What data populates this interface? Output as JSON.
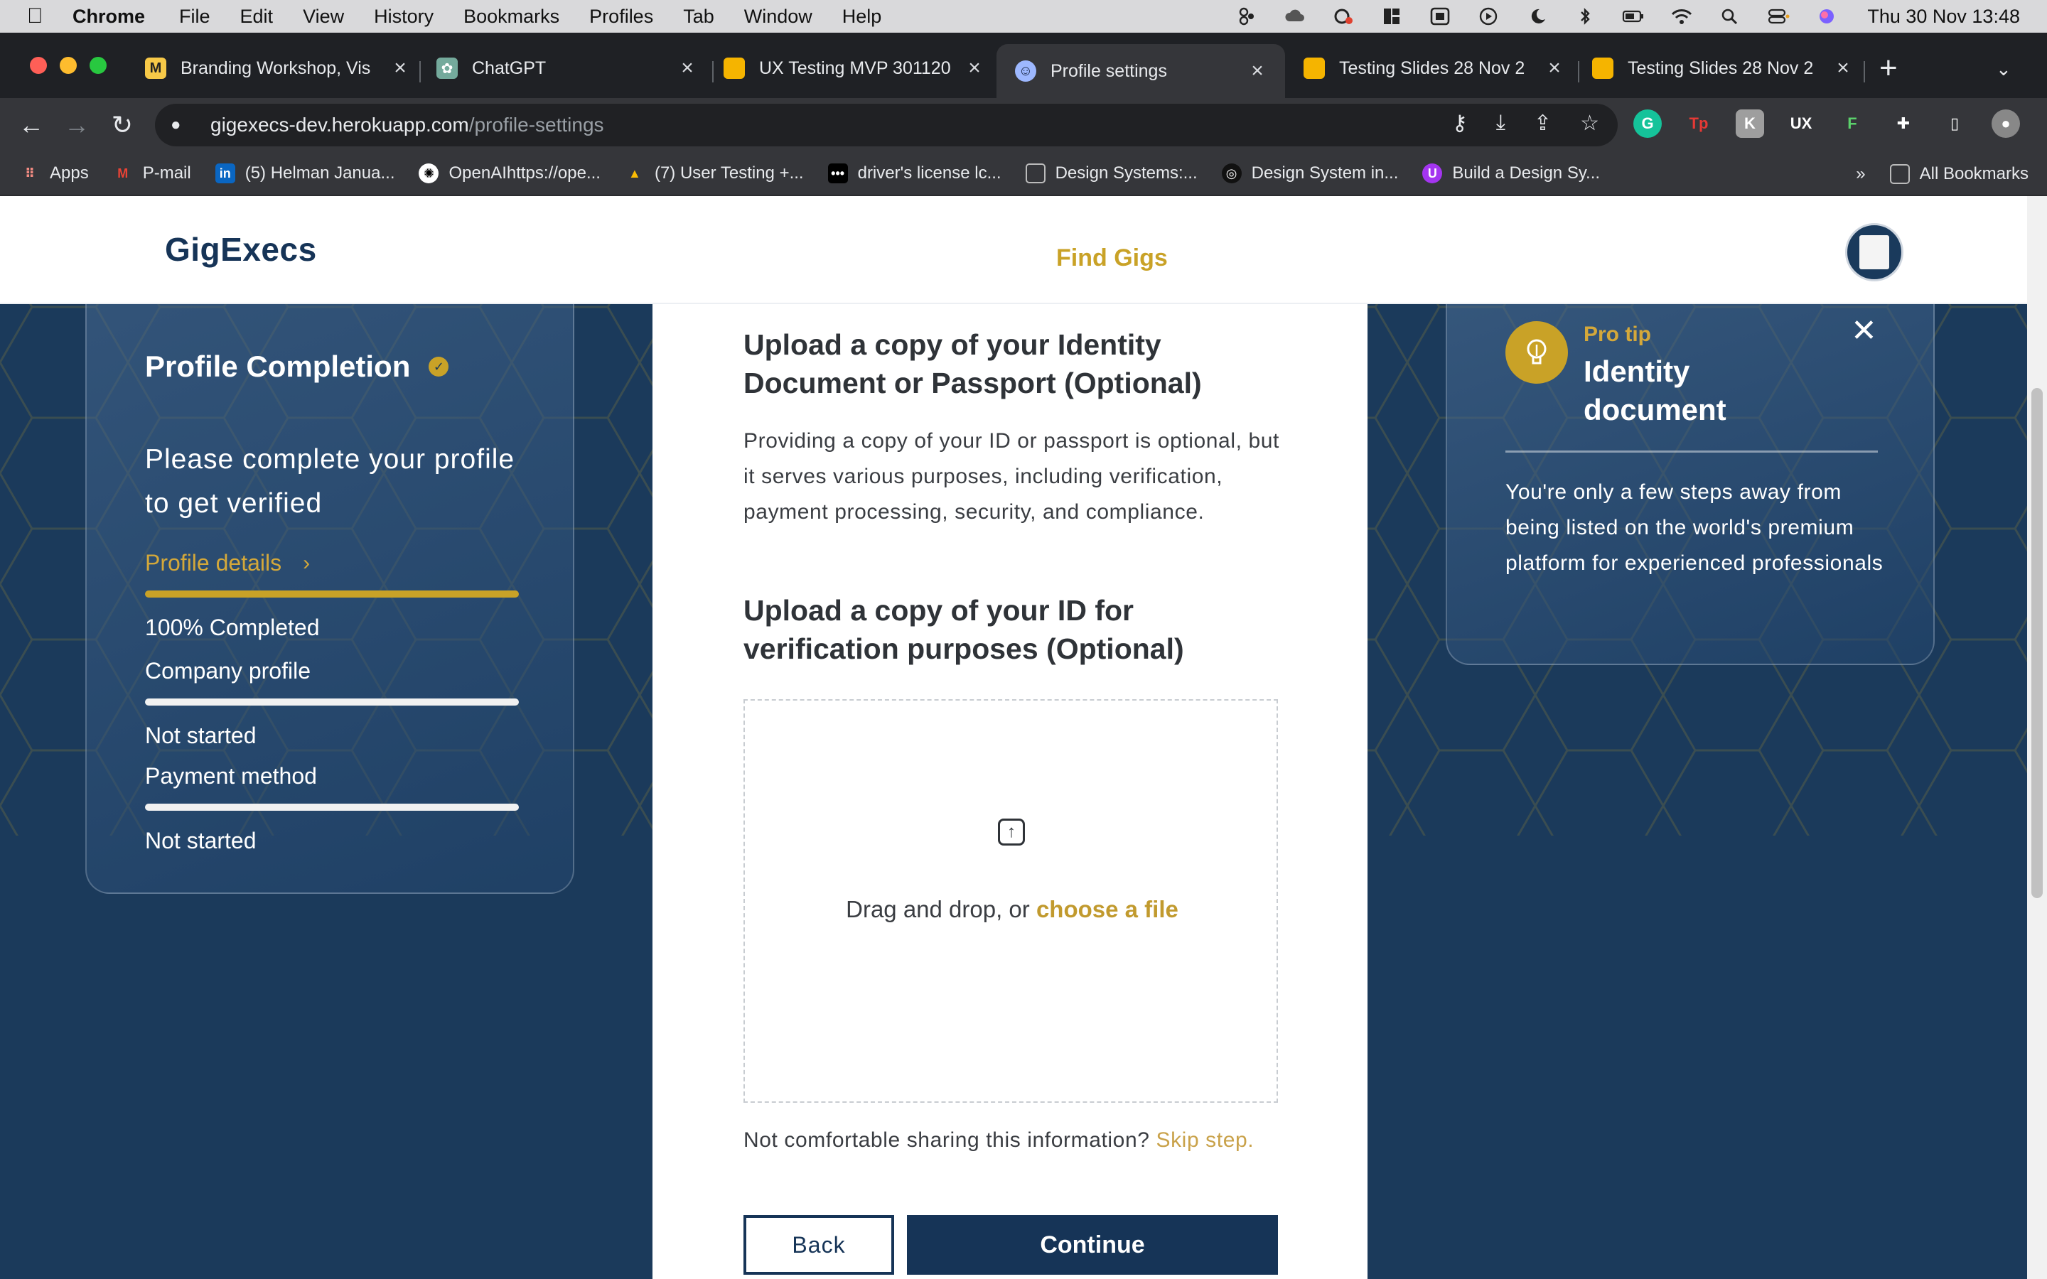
{
  "menubar": {
    "app": "Chrome",
    "items": [
      "File",
      "Edit",
      "View",
      "History",
      "Bookmarks",
      "Profiles",
      "Tab",
      "Window",
      "Help"
    ],
    "clock": "Thu 30 Nov  13:48"
  },
  "tabs": [
    {
      "title": "Branding Workshop, Vis",
      "icon": "miro-icon",
      "color": "#f7c948"
    },
    {
      "title": "ChatGPT",
      "icon": "chatgpt-icon",
      "color": "#74aa9c"
    },
    {
      "title": "UX Testing MVP 301120",
      "icon": "slides-icon",
      "color": "#f5b400"
    },
    {
      "title": "Profile settings",
      "icon": "gigexecs-favicon",
      "color": "#9db8ff"
    },
    {
      "title": "Testing Slides 28 Nov 2",
      "icon": "slides-icon",
      "color": "#f5b400"
    },
    {
      "title": "Testing Slides 28 Nov 2",
      "icon": "slides-icon",
      "color": "#f5b400"
    }
  ],
  "address": {
    "host": "gigexecs-dev.herokuapp.com",
    "path": "/profile-settings"
  },
  "bookmarks": {
    "items": [
      {
        "label": "Apps",
        "icon": "apps-grid-icon"
      },
      {
        "label": "P-mail",
        "icon": "gmail-icon"
      },
      {
        "label": "(5) Helman Janua...",
        "icon": "linkedin-icon"
      },
      {
        "label": "OpenAIhttps://ope...",
        "icon": "openai-icon"
      },
      {
        "label": "(7) User Testing +...",
        "icon": "drive-icon"
      },
      {
        "label": "driver's license lc...",
        "icon": "dots-icon"
      },
      {
        "label": "Design Systems:...",
        "icon": "square-icon"
      },
      {
        "label": "Design System in...",
        "icon": "circle-icon"
      },
      {
        "label": "Build a Design Sy...",
        "icon": "udemy-icon"
      }
    ],
    "overflow": "»",
    "all": "All Bookmarks"
  },
  "site": {
    "logo": "GigExecs",
    "nav_find_gigs": "Find Gigs"
  },
  "completion": {
    "title": "Profile Completion",
    "subtitle": "Please complete your profile to get verified",
    "steps": [
      {
        "label": "Profile details",
        "status": "100% Completed",
        "progress": 1.0
      },
      {
        "label": "Company profile",
        "status": "Not started",
        "progress": 0.0
      },
      {
        "label": "Payment method",
        "status": "Not started",
        "progress": 0.0
      }
    ]
  },
  "main": {
    "heading": "Upload a copy of your Identity Document or Passport (Optional)",
    "description": "Providing a copy of your ID or passport is optional, but it serves various purposes, including verification, payment processing, security, and compliance.",
    "upload_heading": "Upload a copy of your ID for verification purposes (Optional)",
    "dropzone_text": "Drag and drop, or ",
    "dropzone_link": "choose a file",
    "skip_text": "Not comfortable sharing this information? ",
    "skip_link": "Skip step.",
    "back_label": "Back",
    "continue_label": "Continue"
  },
  "tip": {
    "label": "Pro tip",
    "title": "Identity document",
    "body": "You're only a few steps away from being listed on the world's premium platform for experienced professionals"
  },
  "colors": {
    "navy": "#163457",
    "gold": "#c9a227",
    "page_bg": "#1b3a5b"
  }
}
